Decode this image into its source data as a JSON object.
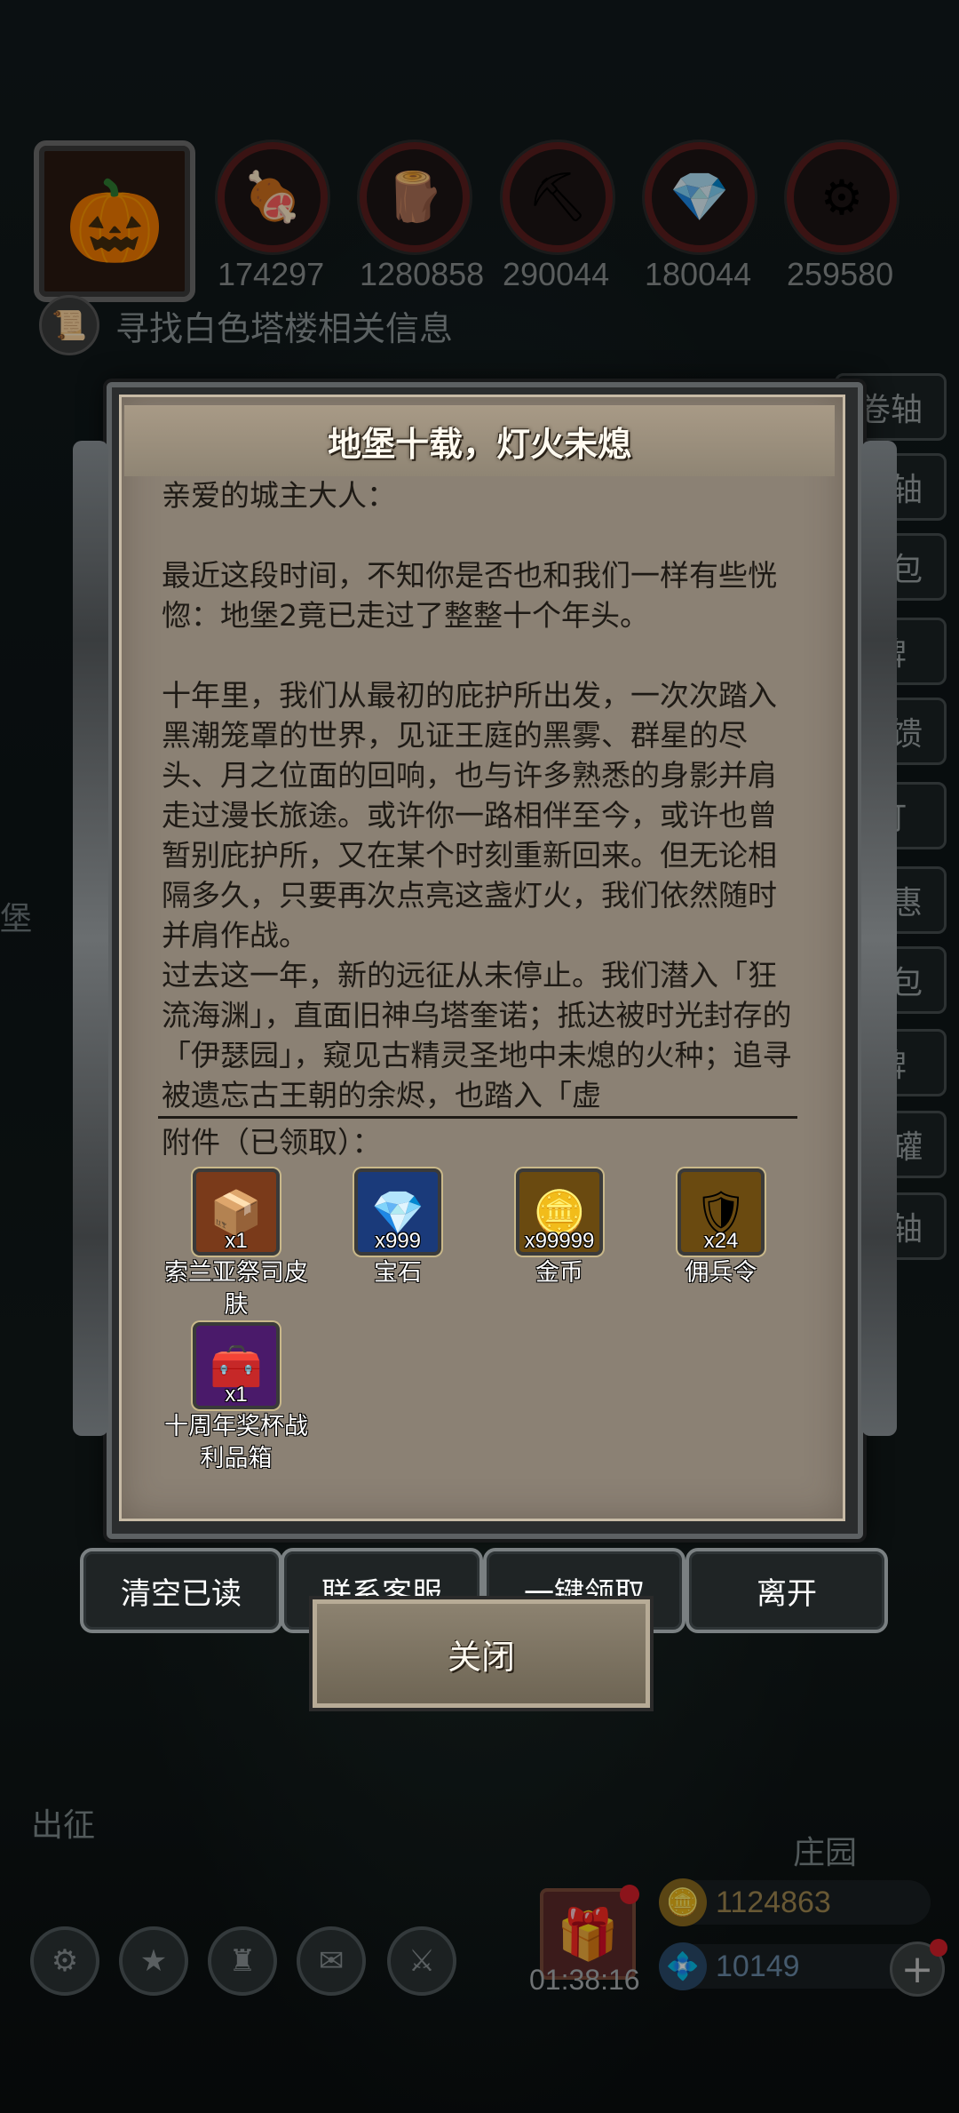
{
  "resources": [
    {
      "icon": "🍖",
      "value": "174297"
    },
    {
      "icon": "🪵",
      "value": "1280858"
    },
    {
      "icon": "⛏",
      "value": "290044"
    },
    {
      "icon": "💎",
      "value": "180044"
    },
    {
      "icon": "⚙",
      "value": "259580"
    }
  ],
  "quest": {
    "text": "寻找白色塔楼相关信息"
  },
  "side_menu": [
    "卷轴",
    "卷轴",
    "礼包",
    "牌",
    "回馈",
    "灯",
    "特惠",
    "礼包",
    "牌",
    "陶罐",
    "卷轴"
  ],
  "left_label": "堡",
  "mail": {
    "title": "地堡十载，灯火未熄",
    "body": "亲爱的城主大人：\n\n最近这段时间，不知你是否也和我们一样有些恍惚：地堡2竟已走过了整整十个年头。\n\n十年里，我们从最初的庇护所出发，一次次踏入黑潮笼罩的世界，见证王庭的黑雾、群星的尽头、月之位面的回响，也与许多熟悉的身影并肩走过漫长旅途。或许你一路相伴至今，或许也曾暂别庇护所，又在某个时刻重新回来。但无论相隔多久，只要再次点亮这盏灯火，我们依然随时并肩作战。\n过去这一年，新的远征从未停止。我们潜入「狂流海渊」，直面旧神乌塔奎诺；抵达被时光封存的「伊瑟园」，窥见古精灵圣地中未熄的火种；追寻被遗忘古王朝的余烬，也踏入「虚",
    "attachments_title": "附件（已领取）：",
    "attachments": [
      {
        "name": "索兰亚祭司皮肤",
        "qty": "x1",
        "icon": "📦",
        "color": "#7a3a1a"
      },
      {
        "name": "宝石",
        "qty": "x999",
        "icon": "💎",
        "color": "#1a3a7a"
      },
      {
        "name": "金币",
        "qty": "x99999",
        "icon": "🪙",
        "color": "#6a4a10"
      },
      {
        "name": "佣兵令",
        "qty": "x24",
        "icon": "🛡",
        "color": "#6a4a10"
      },
      {
        "name": "十周年奖杯战利品箱",
        "qty": "x1",
        "icon": "🧰",
        "color": "#4a1a6a"
      }
    ]
  },
  "actions": {
    "clear_read": "清空已读",
    "contact": "联系客服",
    "claim_all": "一键领取",
    "leave": "离开",
    "close": "关闭"
  },
  "bottom": {
    "expedition": "出征",
    "manor": "庄园",
    "timer": "01:38:16",
    "gold": "1124863",
    "gems": "10149",
    "gold_color": "#a08850",
    "gem_color": "#6a8aa8"
  }
}
